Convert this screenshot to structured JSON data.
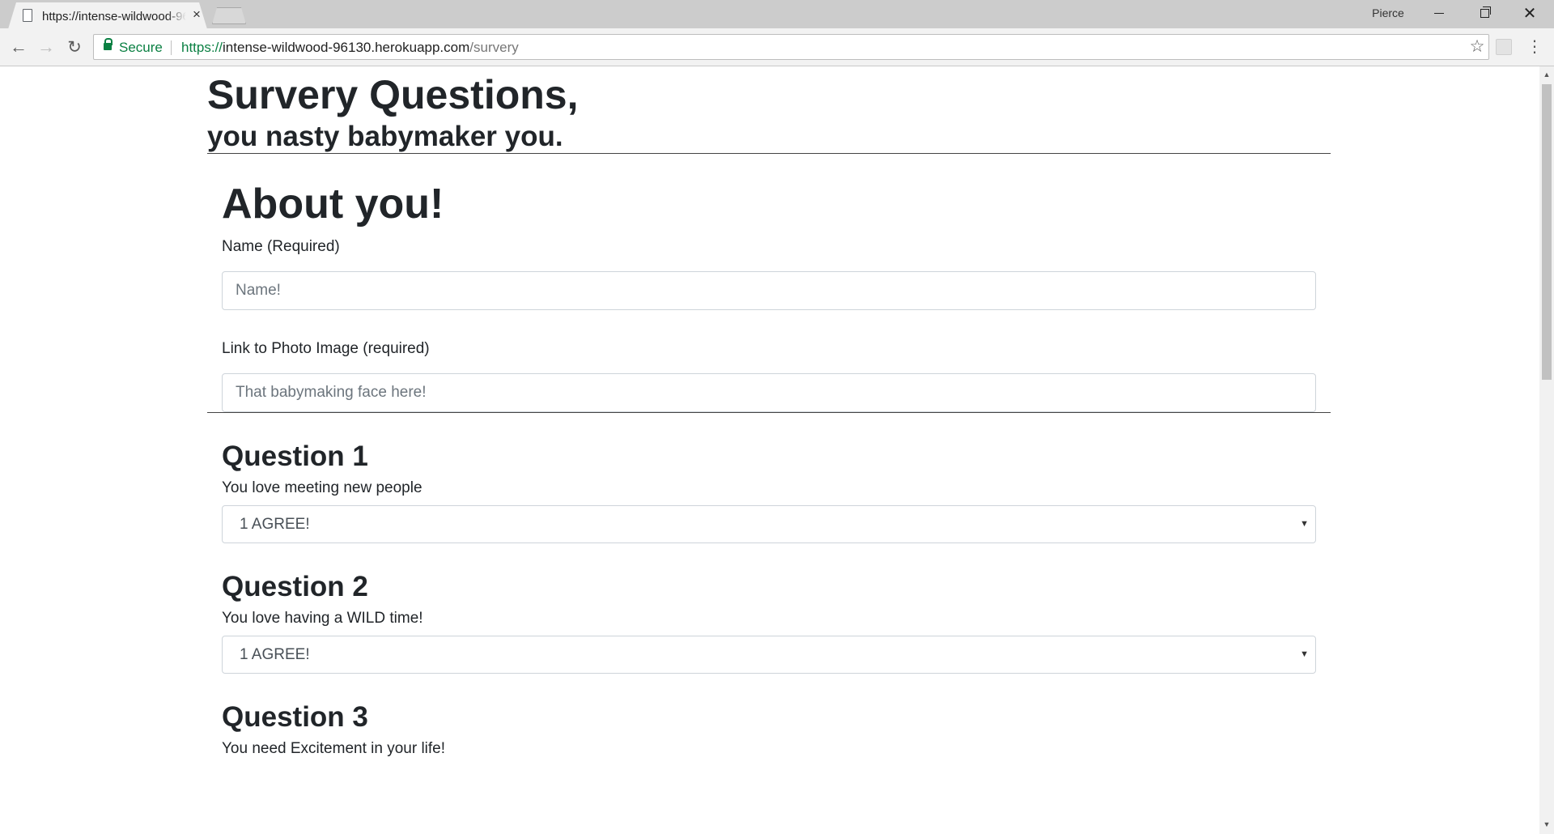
{
  "browser": {
    "tab_title": "https://intense-wildwood-96130.herokuapp.com/survery",
    "tab_close_label": "×",
    "profile_name": "Pierce",
    "secure_label": "Secure",
    "url_scheme": "https://",
    "url_host": "intense-wildwood-96130.herokuapp.com",
    "url_path": "/survery",
    "icons": [
      "page-icon",
      "close-icon",
      "back-icon",
      "forward-icon",
      "reload-icon",
      "lock-icon",
      "star-icon",
      "extension-icon",
      "menu-icon"
    ]
  },
  "page": {
    "title": "Survery Questions,",
    "subtitle": "you nasty babymaker you.",
    "about_heading": "About you!",
    "name_label": "Name (Required)",
    "name_placeholder": "Name!",
    "photo_label": "Link to Photo Image (required)",
    "photo_placeholder": "That babymaking face here!"
  },
  "questions": [
    {
      "heading": "Question 1",
      "text": "You love meeting new people",
      "selected": "1 AGREE!"
    },
    {
      "heading": "Question 2",
      "text": "You love having a WILD time!",
      "selected": "1 AGREE!"
    },
    {
      "heading": "Question 3",
      "text": "You need Excitement in your life!"
    }
  ],
  "colors": {
    "secure_green": "#0b8043",
    "text": "#212529",
    "input_border": "#ced4da"
  }
}
